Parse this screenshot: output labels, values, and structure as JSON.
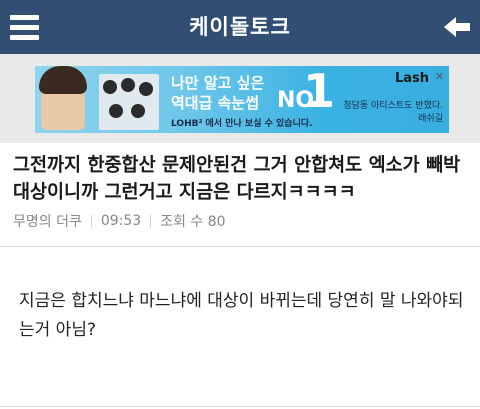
{
  "header": {
    "title": "케이돌토크",
    "menu_icon": "hamburger-menu-icon",
    "back_icon": "back-arrow-icon",
    "bar_color": "#324e73"
  },
  "ad": {
    "line1": "나만 알고 싶은",
    "line2": "역대급 속눈썹",
    "no_label": "NO.",
    "big_number": "1",
    "line3": "LOHB² 에서 만나 보실 수 있습니다.",
    "brand": "Lash",
    "subtext": "청담동 아티스트도 반했다.",
    "subtext2": "래쉬길"
  },
  "post": {
    "title": "그전까지 한중합산 문제안된건 그거 안합쳐도 엑소가 빼박대상이니까 그런거고 지금은 다르지ㅋㅋㅋㅋ",
    "author": "무명의 더쿠",
    "time": "09:53",
    "views": "조회 수 80",
    "body": "지금은 합치느냐 마느냐에 대상이 바뀌는데 당연히 말 나와야되는거 아님?"
  }
}
